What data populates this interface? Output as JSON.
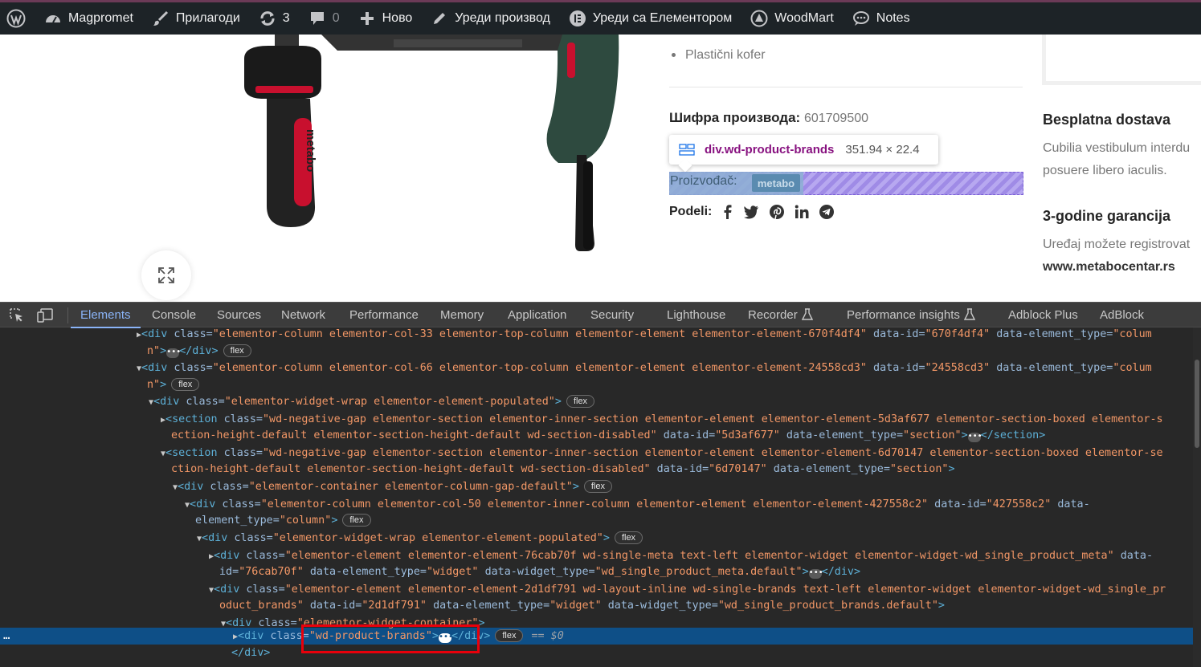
{
  "adminbar": {
    "site_name": "Magpromet",
    "customize": "Прилагоди",
    "updates_count": "3",
    "comments_count": "0",
    "new": "Ново",
    "edit_product": "Уреди производ",
    "edit_elementor": "Уреди са Елементором",
    "woodmart": "WoodMart",
    "notes": "Notes"
  },
  "product": {
    "bullet_item": "Plastični kofer",
    "sku_label": "Шифра производа:",
    "sku_value": "601709500",
    "brand_label": "Proizvođač:",
    "brand_logo": "metabo",
    "share_label": "Podeli:",
    "handle_brand": "metabo"
  },
  "tooltip": {
    "selector": "div.wd-product-brands",
    "size": "351.94 × 22.4"
  },
  "sidebar": {
    "shipping_title": "Besplatna dostava",
    "shipping_text_1": "Cubilia vestibulum interdu",
    "shipping_text_2": "posuere libero iaculis.",
    "warranty_title": "3-godine garancija",
    "warranty_text_1": "Uređaj možete registrovat",
    "warranty_link": "www.metabocentar.rs"
  },
  "devtools": {
    "tabs": [
      "Elements",
      "Console",
      "Sources",
      "Network",
      "Performance",
      "Memory",
      "Application",
      "Security",
      "Lighthouse",
      "Recorder",
      "Performance insights",
      "Adblock Plus",
      "AdBlock"
    ],
    "active_tab": "Elements",
    "selected_suffix": "== $0",
    "badge": "flex",
    "code": {
      "l1_class": "\"elementor-column elementor-col-33 elementor-top-column elementor-element elementor-element-670f4df4\"",
      "l1_id": "\"670f4df4\"",
      "l1_type_a": "\"colum",
      "l1_type_b": "n\"",
      "l2_class": "\"elementor-column elementor-col-66 elementor-top-column elementor-element elementor-element-24558cd3\"",
      "l2_id": "\"24558cd3\"",
      "l2_type_a": "\"colum",
      "l2_type_b": "n\"",
      "l3_class": "\"elementor-widget-wrap elementor-element-populated\"",
      "l4_class_a": "\"wd-negative-gap elementor-section elementor-inner-section elementor-element elementor-element-5d3af677 elementor-section-boxed elementor-s",
      "l4_class_b": "ection-height-default elementor-section-height-default wd-section-disabled\"",
      "l4_id": "\"5d3af677\"",
      "l4_type": "\"section\"",
      "l5_class_a": "\"wd-negative-gap elementor-section elementor-inner-section elementor-element elementor-element-6d70147 elementor-section-boxed elementor-se",
      "l5_class_b": "ction-height-default elementor-section-height-default wd-section-disabled\"",
      "l5_id": "\"6d70147\"",
      "l5_type": "\"section\"",
      "l6_class": "\"elementor-container elementor-column-gap-default\"",
      "l7_class": "\"elementor-column elementor-col-50 elementor-inner-column elementor-element elementor-element-427558c2\"",
      "l7_id": "\"427558c2\"",
      "l7_type": "\"column\"",
      "l8_class": "\"elementor-widget-wrap elementor-element-populated\"",
      "l9_class": "\"elementor-element elementor-element-76cab70f wd-single-meta text-left elementor-widget elementor-widget-wd_single_product_meta\"",
      "l9_id": "\"76cab70f\"",
      "l9_type": "\"widget\"",
      "l9_wtype": "\"wd_single_product_meta.default\"",
      "l10_class_a": "\"elementor-element elementor-element-2d1df791 wd-layout-inline wd-single-brands text-left elementor-widget elementor-widget-wd_single_pr",
      "l10_class_b": "oduct_brands\"",
      "l10_id": "\"2d1df791\"",
      "l10_type": "\"widget\"",
      "l10_wtype": "\"wd_single_product_brands.default\"",
      "l11_class": "\"elementor-widget-container\"",
      "l12_class": "\"wd-product-brands\""
    }
  }
}
